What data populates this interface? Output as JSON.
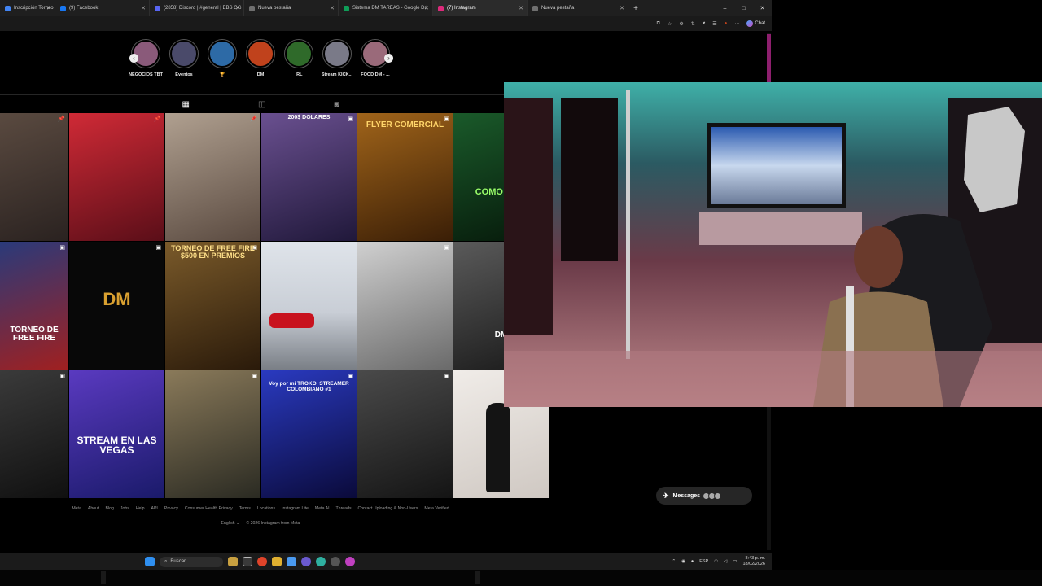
{
  "browser": {
    "tabs": [
      {
        "title": "Inscripción Torneo",
        "color": "#4285f4"
      },
      {
        "title": "(9) Facebook",
        "color": "#1877f2"
      },
      {
        "title": "(2858) Discord | #general | EBS GG",
        "color": "#5865f2"
      },
      {
        "title": "Nueva pestaña",
        "color": "#6f6f6f"
      },
      {
        "title": "Sistema DM TAREAS - Google Dri",
        "color": "#0f9d58"
      },
      {
        "title": "(7) Instagram",
        "color": "#dd2a7b"
      },
      {
        "title": "Nueva pestaña",
        "color": "#6f6f6f"
      }
    ],
    "active_tab": 5,
    "new_tab": "+",
    "close_glyph": "✕",
    "window_controls": [
      "–",
      "□",
      "✕"
    ],
    "toolbar_icons": [
      "⧉",
      "☆",
      "⚙",
      "⇅",
      "♥",
      "☰",
      "●",
      "⋯"
    ],
    "chat_label": "Chat"
  },
  "instagram": {
    "stories": [
      {
        "label": "NEGOCIOS TBT",
        "color": "#8a5a7a"
      },
      {
        "label": "Eventos",
        "color": "#4a4a6a"
      },
      {
        "label": "🏆",
        "color": "#2d6aa6"
      },
      {
        "label": "DM",
        "color": "#c0421c"
      },
      {
        "label": "IRL",
        "color": "#2f6a2a"
      },
      {
        "label": "Stream KICK...",
        "color": "#7a7a88"
      },
      {
        "label": "FOOD DM - ...",
        "color": "#9a6a7a"
      }
    ],
    "tab_icons": [
      "▦",
      "◫",
      "◙"
    ],
    "posts": [
      {
        "color": "#3a3230",
        "text": "",
        "pin": "📌"
      },
      {
        "color": "#b8202c",
        "text": "",
        "pin": "📌"
      },
      {
        "color": "#8a7a70",
        "text": "",
        "pin": "📌"
      },
      {
        "color": "#4a4060",
        "text": "200$ DOLARES",
        "pin": "▣"
      },
      {
        "color": "#6a3e10",
        "text": "FLYER COMERCIAL",
        "pin": "▣"
      },
      {
        "color": "#0e3a16",
        "text": "COMO DINE",
        "pin": ""
      },
      {
        "color": "#1e2c5a",
        "text": "TORNEO DE FREE FIRE",
        "pin": "▣"
      },
      {
        "color": "#0a0a0a",
        "text": "DM",
        "pin": "▣"
      },
      {
        "color": "#5a3a1c",
        "text": "TORNEO DE FREE FIRE $500 EN PREMIOS",
        "pin": "▣"
      },
      {
        "color": "#9aa0a8",
        "text": "",
        "pin": ""
      },
      {
        "color": "#9a9a9a",
        "text": "",
        "pin": "▣"
      },
      {
        "color": "#3a3a3a",
        "text": "DM",
        "pin": ""
      },
      {
        "color": "#1c1c1c",
        "text": "",
        "pin": "▣"
      },
      {
        "color": "#2a2a9a",
        "text": "STREAM EN LAS VEGAS",
        "pin": ""
      },
      {
        "color": "#4a4a3a",
        "text": "",
        "pin": "▣"
      },
      {
        "color": "#1a2a8a",
        "text": "Voy por mi TROKO, STREAMER COLOMBIANO #1",
        "pin": "▣"
      },
      {
        "color": "#2a2a2a",
        "text": "",
        "pin": "▣"
      },
      {
        "color": "#e8e4e0",
        "text": "",
        "pin": ""
      }
    ],
    "footer_links": [
      "Meta",
      "About",
      "Blog",
      "Jobs",
      "Help",
      "API",
      "Privacy",
      "Consumer Health Privacy",
      "Terms",
      "Locations",
      "Instagram Lite",
      "Meta AI",
      "Threads",
      "Contact Uploading & Non-Users",
      "Meta Verified"
    ],
    "language": "English ⌄",
    "copyright": "© 2026 Instagram from Meta",
    "messages_label": "Messages"
  },
  "taskbar": {
    "search_placeholder": "Buscar",
    "language": "ESP",
    "time": "8:43 p. m.",
    "date": "18/02/2026"
  }
}
